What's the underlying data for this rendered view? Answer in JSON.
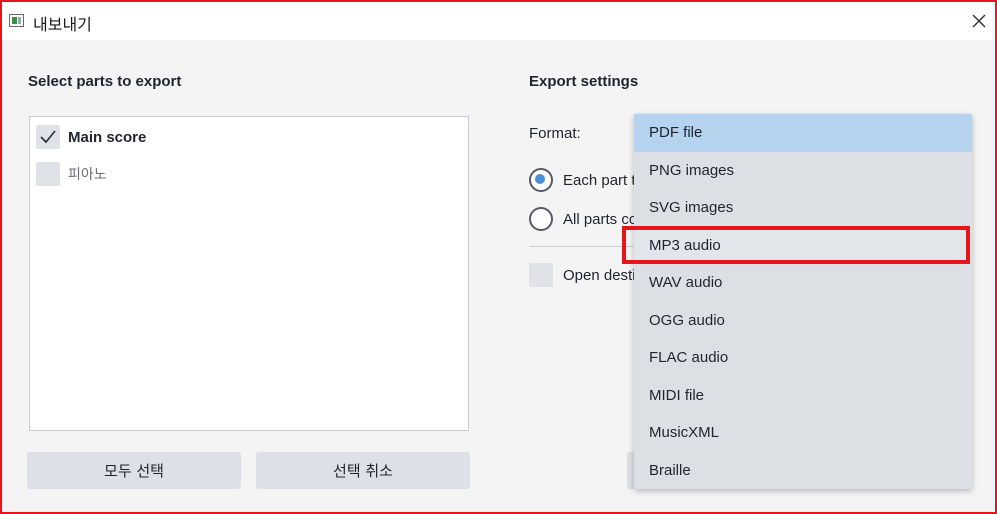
{
  "window": {
    "title": "내보내기"
  },
  "left": {
    "section_title": "Select parts to export",
    "parts": [
      {
        "label": "Main score",
        "checked": true
      },
      {
        "label": "피아노",
        "checked": false
      }
    ],
    "select_all_label": "모두 선택",
    "deselect_label": "선택 취소"
  },
  "right": {
    "section_title": "Export settings",
    "format_label": "Format:",
    "radio_each_label": "Each part to",
    "radio_all_label": "All parts co",
    "open_destination_label": "Open desti"
  },
  "dropdown": {
    "selected": "PDF file",
    "hovered": "MP3 audio",
    "options": [
      "PDF file",
      "PNG images",
      "SVG images",
      "MP3 audio",
      "WAV audio",
      "OGG audio",
      "FLAC audio",
      "MIDI file",
      "MusicXML",
      "Braille"
    ]
  },
  "colors": {
    "accent": "#4a90d9",
    "selected_option_bg": "#b5d2ef",
    "annotation_red": "#e8141b"
  },
  "icons": {
    "app": "app-icon",
    "close": "close-icon",
    "check": "checkmark-icon"
  }
}
